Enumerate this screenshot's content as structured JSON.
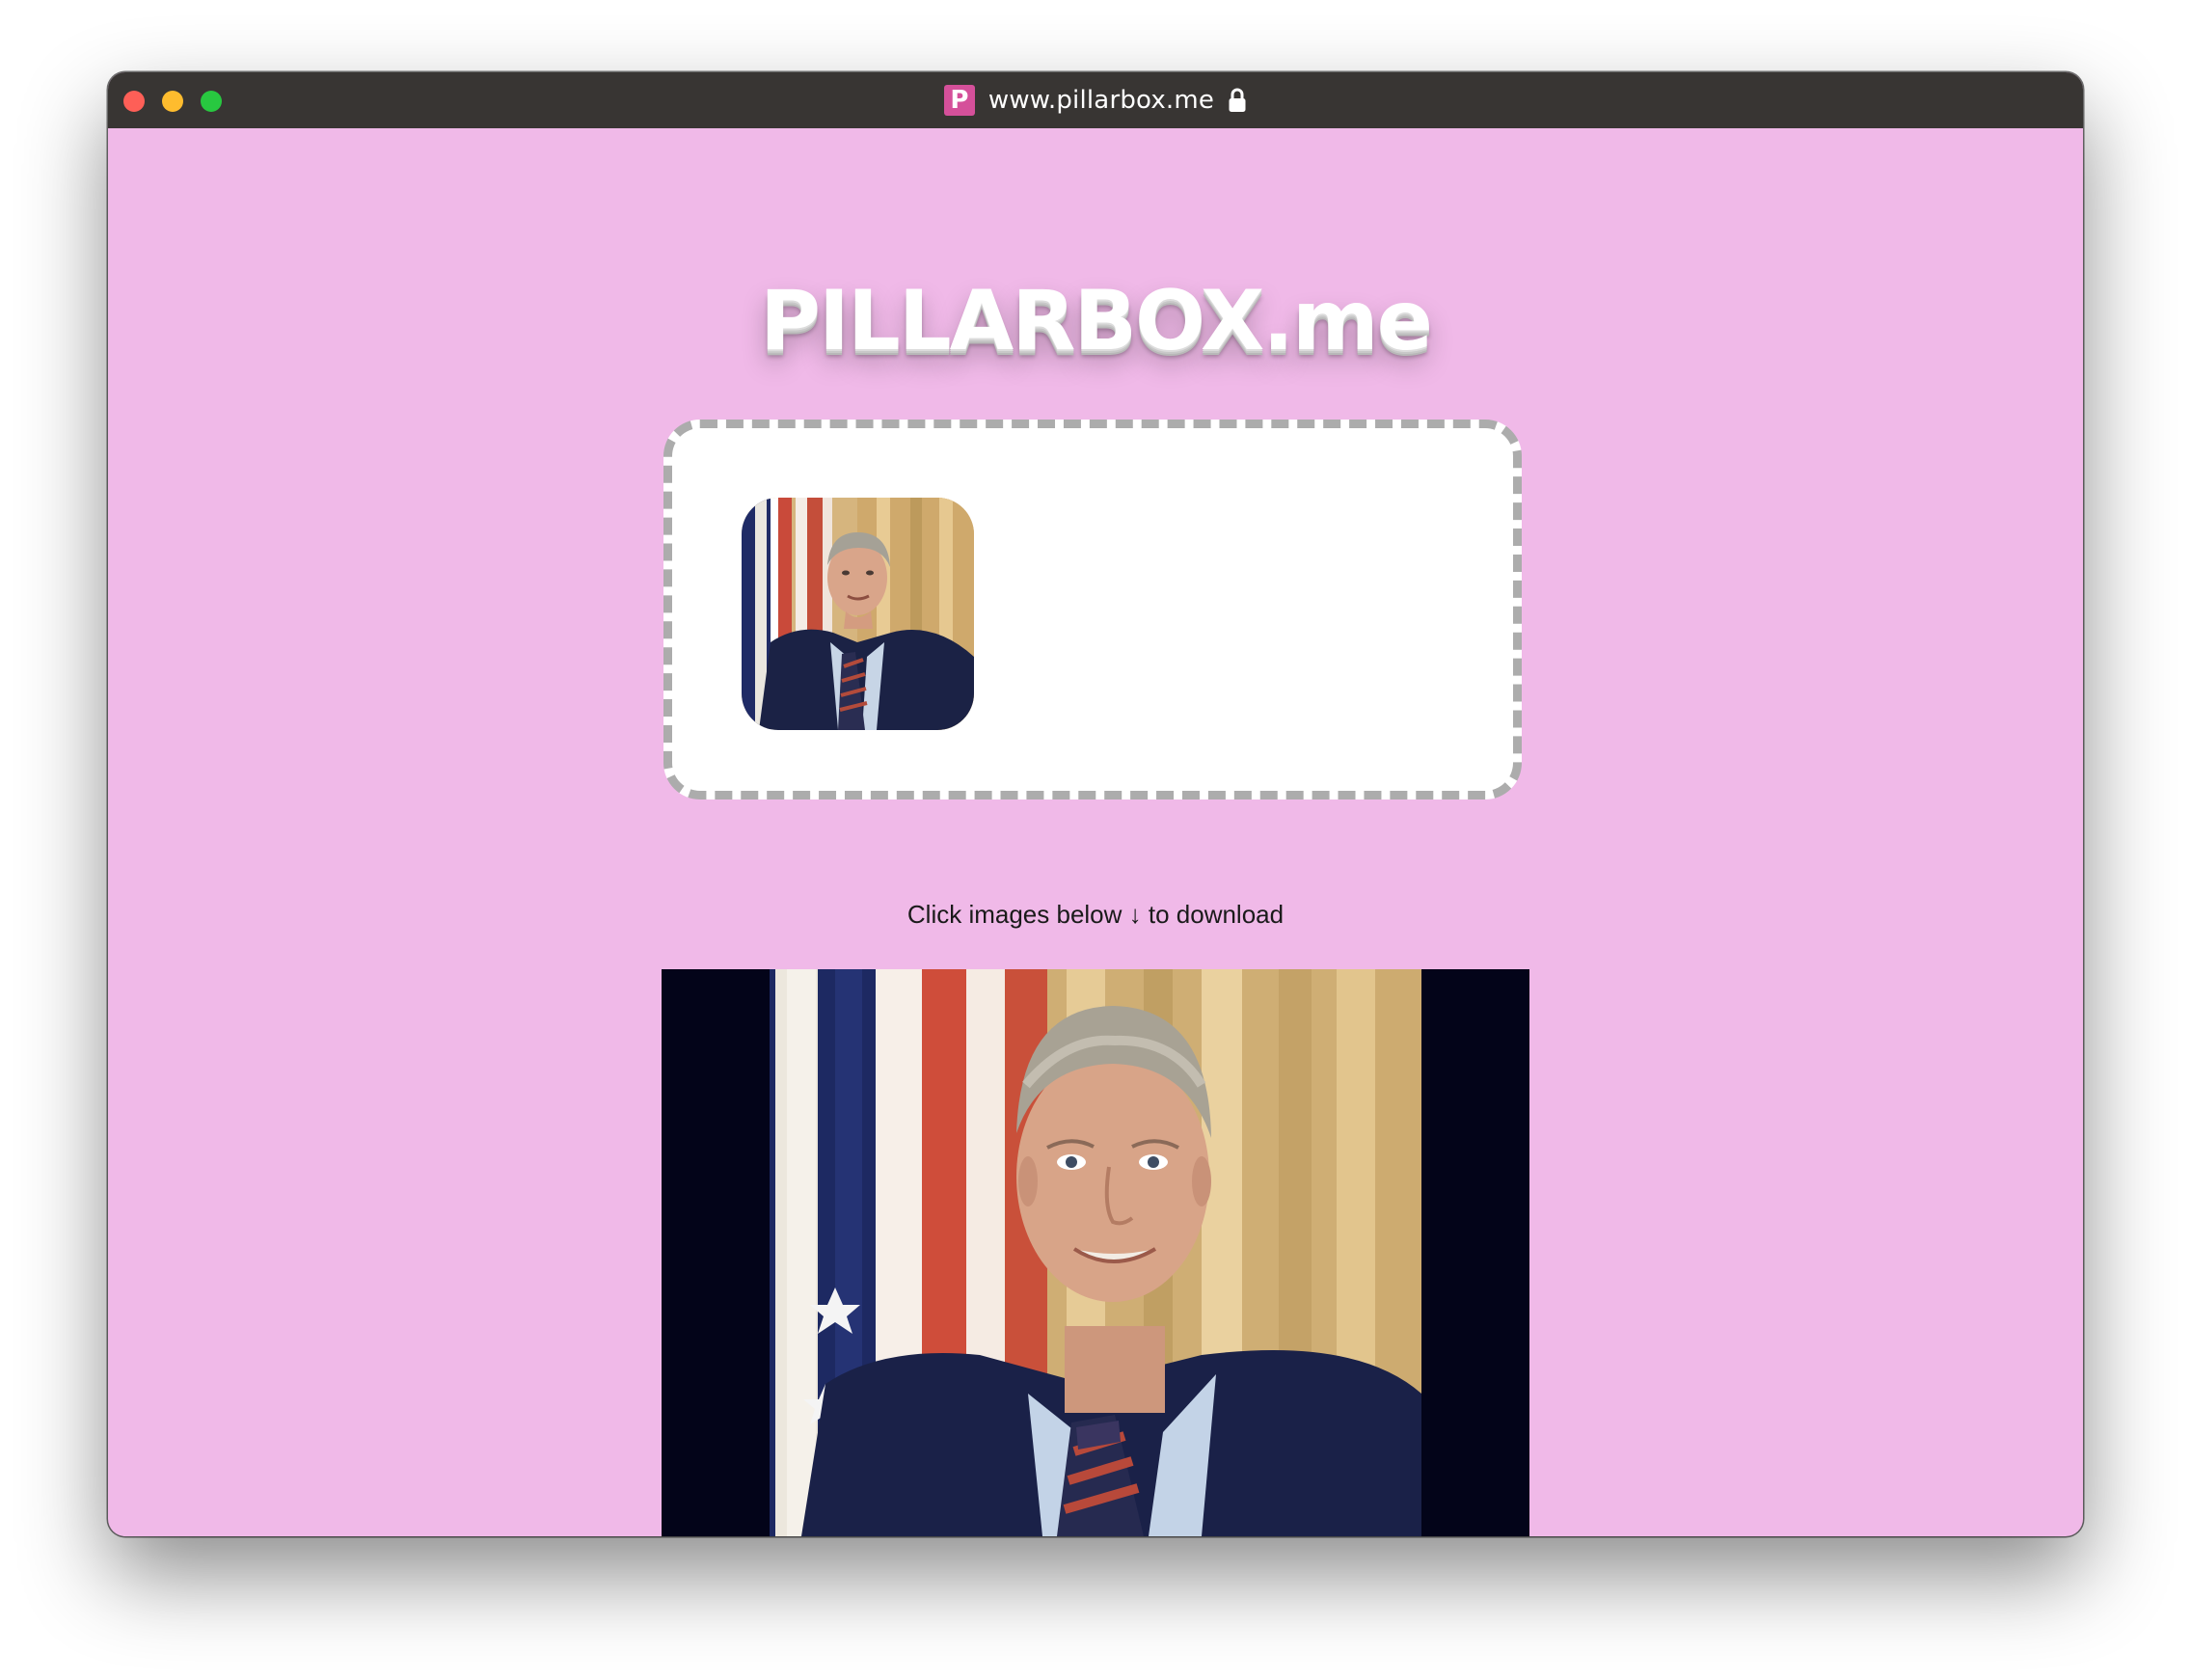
{
  "browser": {
    "url": "www.pillarbox.me",
    "favicon_letter": "P",
    "favicon_color": "#d5509a",
    "lock_icon": "lock-icon"
  },
  "page": {
    "title": "PILLARBOX.me",
    "background_color": "#f0b9e8",
    "download_hint": "Click images below ↓ to download"
  },
  "colors": {
    "dropzone_border": "#acacac",
    "pillarbox_fill": "#030419"
  }
}
